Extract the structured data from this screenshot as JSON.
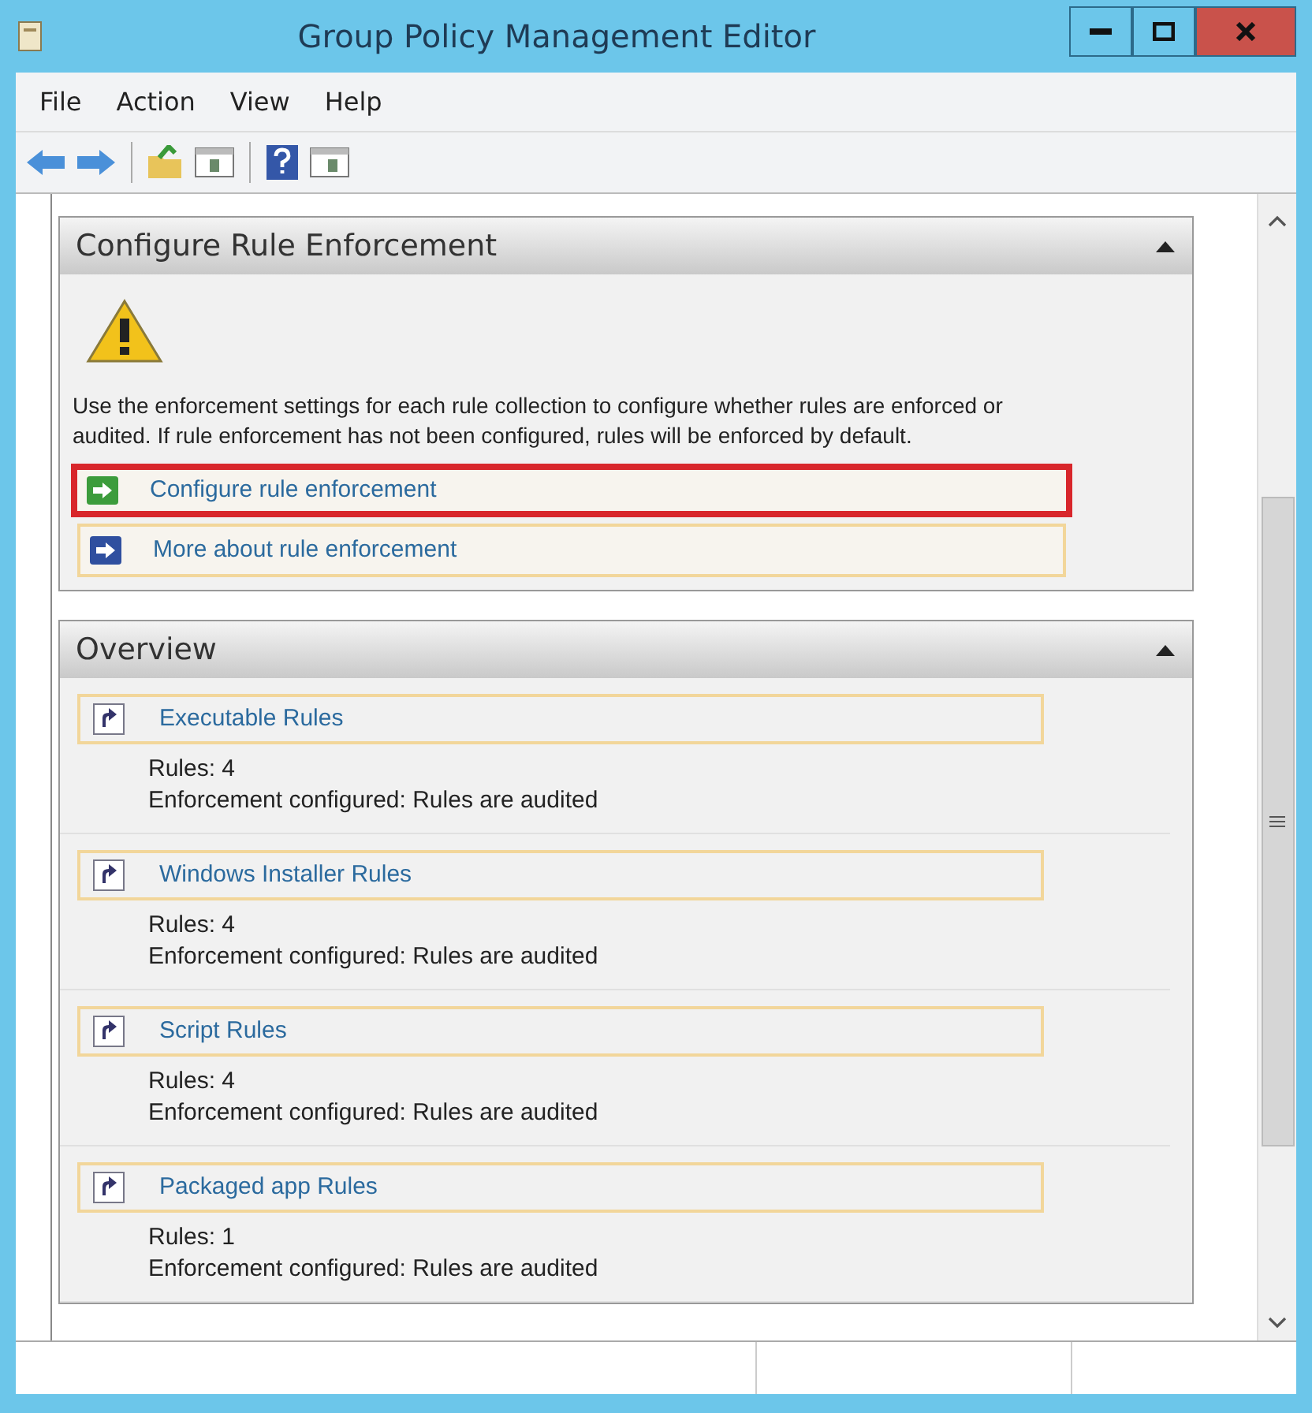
{
  "window": {
    "title": "Group Policy Management Editor"
  },
  "menu": [
    "File",
    "Action",
    "View",
    "Help"
  ],
  "sections": [
    {
      "kind": "enforcement",
      "title": "Configure Rule Enforcement",
      "expanded": true,
      "description": "Use the enforcement settings for each rule collection to configure whether rules are enforced or audited. If rule enforcement has not been configured, rules will be enforced by default.",
      "links": [
        {
          "label": "Configure rule enforcement",
          "color": "#3c9c3c",
          "highlighted": true
        },
        {
          "label": "More about rule enforcement",
          "color": "#2f4f9f",
          "highlighted": false
        }
      ]
    },
    {
      "kind": "overview",
      "title": "Overview",
      "expanded": true,
      "items": [
        {
          "label": "Executable Rules",
          "rules": "Rules: 4",
          "enforcement": "Enforcement configured: Rules are audited"
        },
        {
          "label": "Windows Installer Rules",
          "rules": "Rules: 4",
          "enforcement": "Enforcement configured: Rules are audited"
        },
        {
          "label": "Script Rules",
          "rules": "Rules: 4",
          "enforcement": "Enforcement configured: Rules are audited"
        },
        {
          "label": "Packaged app Rules",
          "rules": "Rules: 1",
          "enforcement": "Enforcement configured: Rules are audited"
        }
      ]
    }
  ]
}
